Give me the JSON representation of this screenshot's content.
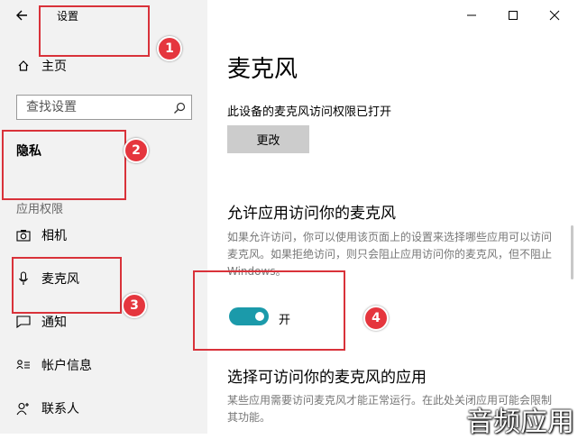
{
  "window": {
    "title": "设置"
  },
  "sidebar": {
    "home": "主页",
    "search_placeholder": "查找设置",
    "section": "隐私",
    "group_label": "应用权限",
    "items": [
      {
        "label": "相机",
        "icon": "camera-icon"
      },
      {
        "label": "麦克风",
        "icon": "microphone-icon",
        "selected": true
      },
      {
        "label": "通知",
        "icon": "notification-icon"
      },
      {
        "label": "帐户信息",
        "icon": "account-info-icon"
      },
      {
        "label": "联系人",
        "icon": "contacts-icon"
      }
    ]
  },
  "main": {
    "title": "麦克风",
    "device_status": "此设备的麦克风访问权限已打开",
    "change_label": "更改",
    "allow_heading": "允许应用访问你的麦克风",
    "allow_desc": "如果允许访问，你可以使用该页面上的设置来选择哪些应用可以访问麦克风。如果拒绝访问，则只会阻止应用访问你的麦克风，但不阻止 Windows。",
    "toggle_label": "开",
    "toggle_on": true,
    "choose_heading": "选择可访问你的麦克风的应用",
    "choose_desc": "某些应用需要访问麦克风才能正常运行。在此处关闭应用可能会限制其功能。"
  },
  "annotations": {
    "labels": [
      "1",
      "2",
      "3",
      "4"
    ],
    "color": "#e5363e"
  },
  "watermark": "音频应用",
  "colors": {
    "accent": "#1b9aaa",
    "sidebar_bg": "#f2f2f2"
  }
}
